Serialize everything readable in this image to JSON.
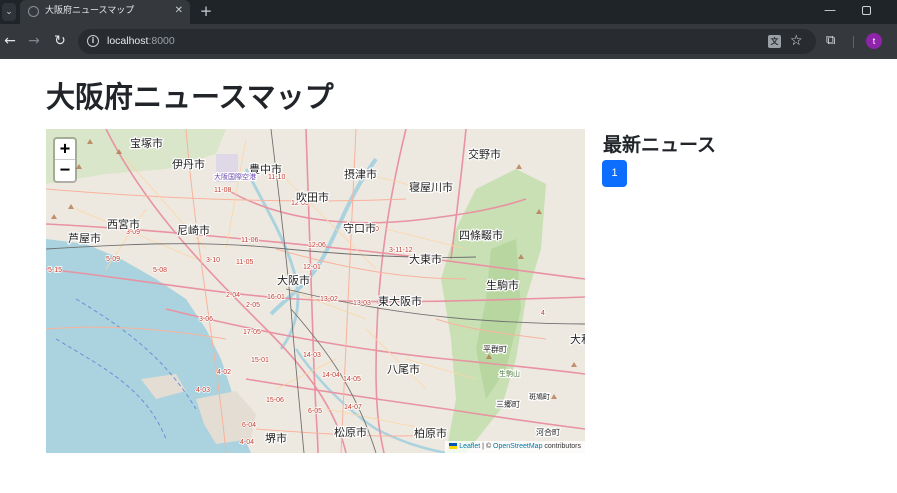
{
  "browser": {
    "tab_title": "大阪府ニュースマップ",
    "url_host": "localhost",
    "url_port": ":8000",
    "profile_initial": "t"
  },
  "page": {
    "title": "大阪府ニュースマップ"
  },
  "map": {
    "zoom_in_label": "+",
    "zoom_out_label": "−",
    "attribution": {
      "leaflet": "Leaflet",
      "separator": " | © ",
      "osm": "OpenStreetMap",
      "contributors": " contributors"
    },
    "place_labels": [
      "宝塚市",
      "伊丹市",
      "豊中市",
      "交野市",
      "摂津市",
      "寝屋川市",
      "吹田市",
      "西宮市",
      "尼崎市",
      "守口市",
      "四條畷市",
      "芦屋市",
      "大東市",
      "大阪市",
      "東大阪市",
      "生駒市",
      "八尾市",
      "堺市",
      "松原市",
      "柏原市",
      "平群町",
      "三郷町",
      "河合町",
      "大和",
      "大阪国際空港",
      "生駒山",
      "斑鳩町"
    ]
  },
  "news": {
    "heading": "最新ニュース",
    "pages": [
      "1"
    ]
  },
  "colors": {
    "primary": "#0d6efd",
    "water": "#aad3df",
    "park": "#c8e0b4"
  }
}
